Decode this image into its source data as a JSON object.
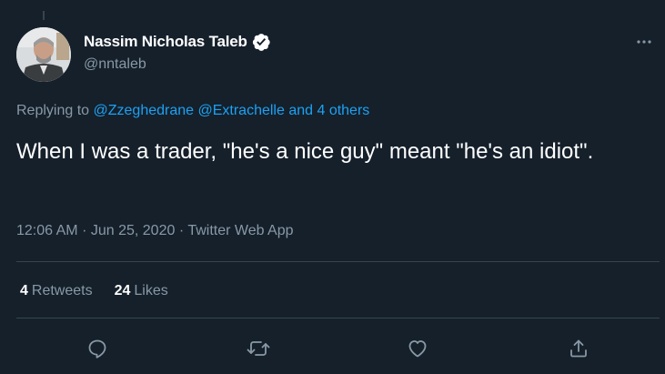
{
  "author": {
    "display_name": "Nassim Nicholas Taleb",
    "handle": "@nntaleb",
    "verified": true
  },
  "reply_context": {
    "prefix": "Replying to",
    "mentions": [
      "@Zzeghedrane",
      "@Extrachelle"
    ],
    "others": "and 4 others"
  },
  "tweet": {
    "text": "When I was a trader, \"he's a nice guy\" meant \"he's an idiot\".",
    "time": "12:06 AM",
    "date": "Jun 25, 2020",
    "source": "Twitter Web App"
  },
  "stats": {
    "retweets_count": "4",
    "retweets_label": "Retweets",
    "likes_count": "24",
    "likes_label": "Likes"
  },
  "icons": {
    "more": "more-dots-icon",
    "verified": "verified-badge-icon",
    "reply": "reply-icon",
    "retweet": "retweet-icon",
    "like": "like-icon",
    "share": "share-icon"
  },
  "colors": {
    "background": "#15202b",
    "accent": "#1da1f2",
    "secondary_text": "#8899a6",
    "divider": "#38444d"
  }
}
